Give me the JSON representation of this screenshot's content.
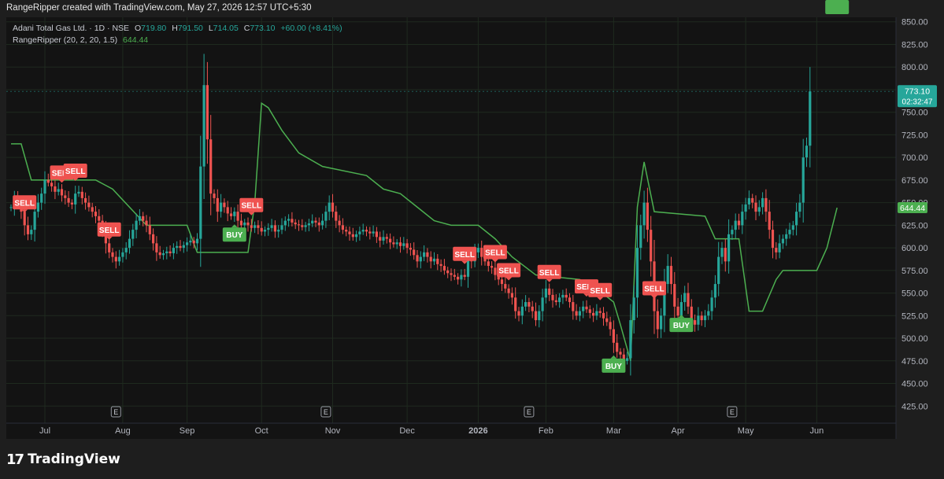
{
  "header": "RangeRipper created with TradingView.com, May 27, 2026 12:57 UTC+5:30",
  "legend": {
    "symbol": "Adani Total Gas Ltd. · 1D · NSE",
    "o_label": "O",
    "o": "719.80",
    "h_label": "H",
    "h": "791.50",
    "l_label": "L",
    "l": "714.05",
    "c_label": "C",
    "c": "773.10",
    "change": "+60.00 (+8.41%)",
    "indicator": "RangeRipper (20, 2, 20, 1.5)",
    "indicator_value": "644.44"
  },
  "price_badge": {
    "price": "773.10",
    "countdown": "02:32:47",
    "color": "#26a69a"
  },
  "indicator_badge": {
    "value": "644.44",
    "color": "#4caf50"
  },
  "footer": {
    "logo_mark": "17",
    "logo_text": "TradingView"
  },
  "colors": {
    "up": "#26a69a",
    "down": "#ef5350",
    "line": "#4caf50",
    "sell": "#ef5350",
    "buy": "#4caf50"
  },
  "chart_data": {
    "type": "candlestick",
    "y_axis": {
      "ylim": [
        420,
        855
      ],
      "ticks": [
        425,
        450,
        475,
        500,
        525,
        550,
        575,
        600,
        625,
        650,
        675,
        700,
        725,
        750,
        775,
        800,
        825,
        850
      ]
    },
    "x_axis": {
      "labels": [
        "Jul",
        "Aug",
        "Sep",
        "Oct",
        "Nov",
        "Dec",
        "2026",
        "Feb",
        "Mar",
        "Apr",
        "May",
        "Jun"
      ],
      "label_bar_index": [
        10,
        33,
        52,
        74,
        95,
        117,
        138,
        158,
        178,
        197,
        217,
        238
      ]
    },
    "earnings_markers": {
      "label": "E",
      "bar_index": [
        31,
        93,
        153,
        213
      ]
    },
    "close": [
      645,
      655,
      650,
      640,
      625,
      615,
      620,
      640,
      650,
      660,
      675,
      672,
      668,
      662,
      665,
      658,
      655,
      650,
      648,
      660,
      662,
      655,
      650,
      645,
      640,
      635,
      630,
      620,
      605,
      595,
      590,
      585,
      590,
      595,
      600,
      610,
      620,
      630,
      635,
      630,
      625,
      615,
      605,
      595,
      592,
      594,
      596,
      594,
      600,
      602,
      600,
      603,
      606,
      608,
      605,
      610,
      690,
      780,
      720,
      660,
      655,
      640,
      650,
      645,
      638,
      635,
      640,
      630,
      625,
      628,
      625,
      622,
      625,
      622,
      618,
      620,
      622,
      625,
      618,
      620,
      625,
      630,
      632,
      628,
      626,
      625,
      623,
      625,
      627,
      630,
      628,
      625,
      630,
      640,
      650,
      640,
      630,
      625,
      620,
      618,
      615,
      612,
      615,
      618,
      620,
      618,
      616,
      618,
      612,
      608,
      612,
      610,
      606,
      604,
      606,
      602,
      605,
      600,
      598,
      592,
      585,
      590,
      595,
      590,
      585,
      588,
      582,
      580,
      575,
      572,
      570,
      568,
      565,
      570,
      568,
      590,
      585,
      595,
      600,
      590,
      585,
      580,
      578,
      570,
      565,
      560,
      555,
      550,
      545,
      530,
      525,
      535,
      540,
      535,
      530,
      520,
      530,
      545,
      555,
      548,
      542,
      540,
      545,
      548,
      545,
      540,
      530,
      525,
      530,
      535,
      532,
      528,
      525,
      530,
      528,
      522,
      518,
      510,
      495,
      485,
      482,
      475,
      478,
      520,
      545,
      600,
      625,
      650,
      620,
      585,
      530,
      510,
      525,
      560,
      580,
      560,
      535,
      525,
      540,
      550,
      535,
      520,
      515,
      525,
      520,
      525,
      530,
      545,
      560,
      590,
      600,
      585,
      615,
      620,
      630,
      625,
      640,
      648,
      655,
      650,
      640,
      645,
      655,
      640,
      620,
      600,
      595,
      605,
      610,
      615,
      620,
      625,
      640,
      650,
      700,
      713,
      773
    ],
    "sell_signals": {
      "label": "SELL",
      "bar_index": [
        4,
        15,
        19,
        29,
        71,
        134,
        143,
        147,
        159,
        170,
        174,
        190
      ]
    },
    "buy_signals": {
      "label": "BUY",
      "bar_index": [
        66,
        178,
        198,
        244
      ]
    },
    "indicator_line": {
      "name": "RangeRipper (20, 2, 20, 1.5)",
      "breakpoints": [
        [
          0,
          715
        ],
        [
          3,
          715
        ],
        [
          6,
          675
        ],
        [
          25,
          675
        ],
        [
          30,
          665
        ],
        [
          40,
          625
        ],
        [
          52,
          625
        ],
        [
          55,
          595
        ],
        [
          70,
          595
        ],
        [
          72,
          650
        ],
        [
          74,
          760
        ],
        [
          76,
          755
        ],
        [
          80,
          730
        ],
        [
          85,
          705
        ],
        [
          92,
          690
        ],
        [
          105,
          680
        ],
        [
          110,
          665
        ],
        [
          115,
          660
        ],
        [
          120,
          645
        ],
        [
          125,
          630
        ],
        [
          130,
          625
        ],
        [
          138,
          625
        ],
        [
          143,
          610
        ],
        [
          148,
          590
        ],
        [
          155,
          570
        ],
        [
          168,
          565
        ],
        [
          173,
          555
        ],
        [
          178,
          540
        ],
        [
          180,
          515
        ],
        [
          183,
          475
        ],
        [
          185,
          645
        ],
        [
          187,
          695
        ],
        [
          190,
          640
        ],
        [
          205,
          635
        ],
        [
          208,
          610
        ],
        [
          215,
          610
        ],
        [
          218,
          530
        ],
        [
          222,
          530
        ],
        [
          226,
          565
        ],
        [
          228,
          575
        ],
        [
          238,
          575
        ],
        [
          241,
          600
        ],
        [
          244,
          644.44
        ]
      ]
    }
  }
}
